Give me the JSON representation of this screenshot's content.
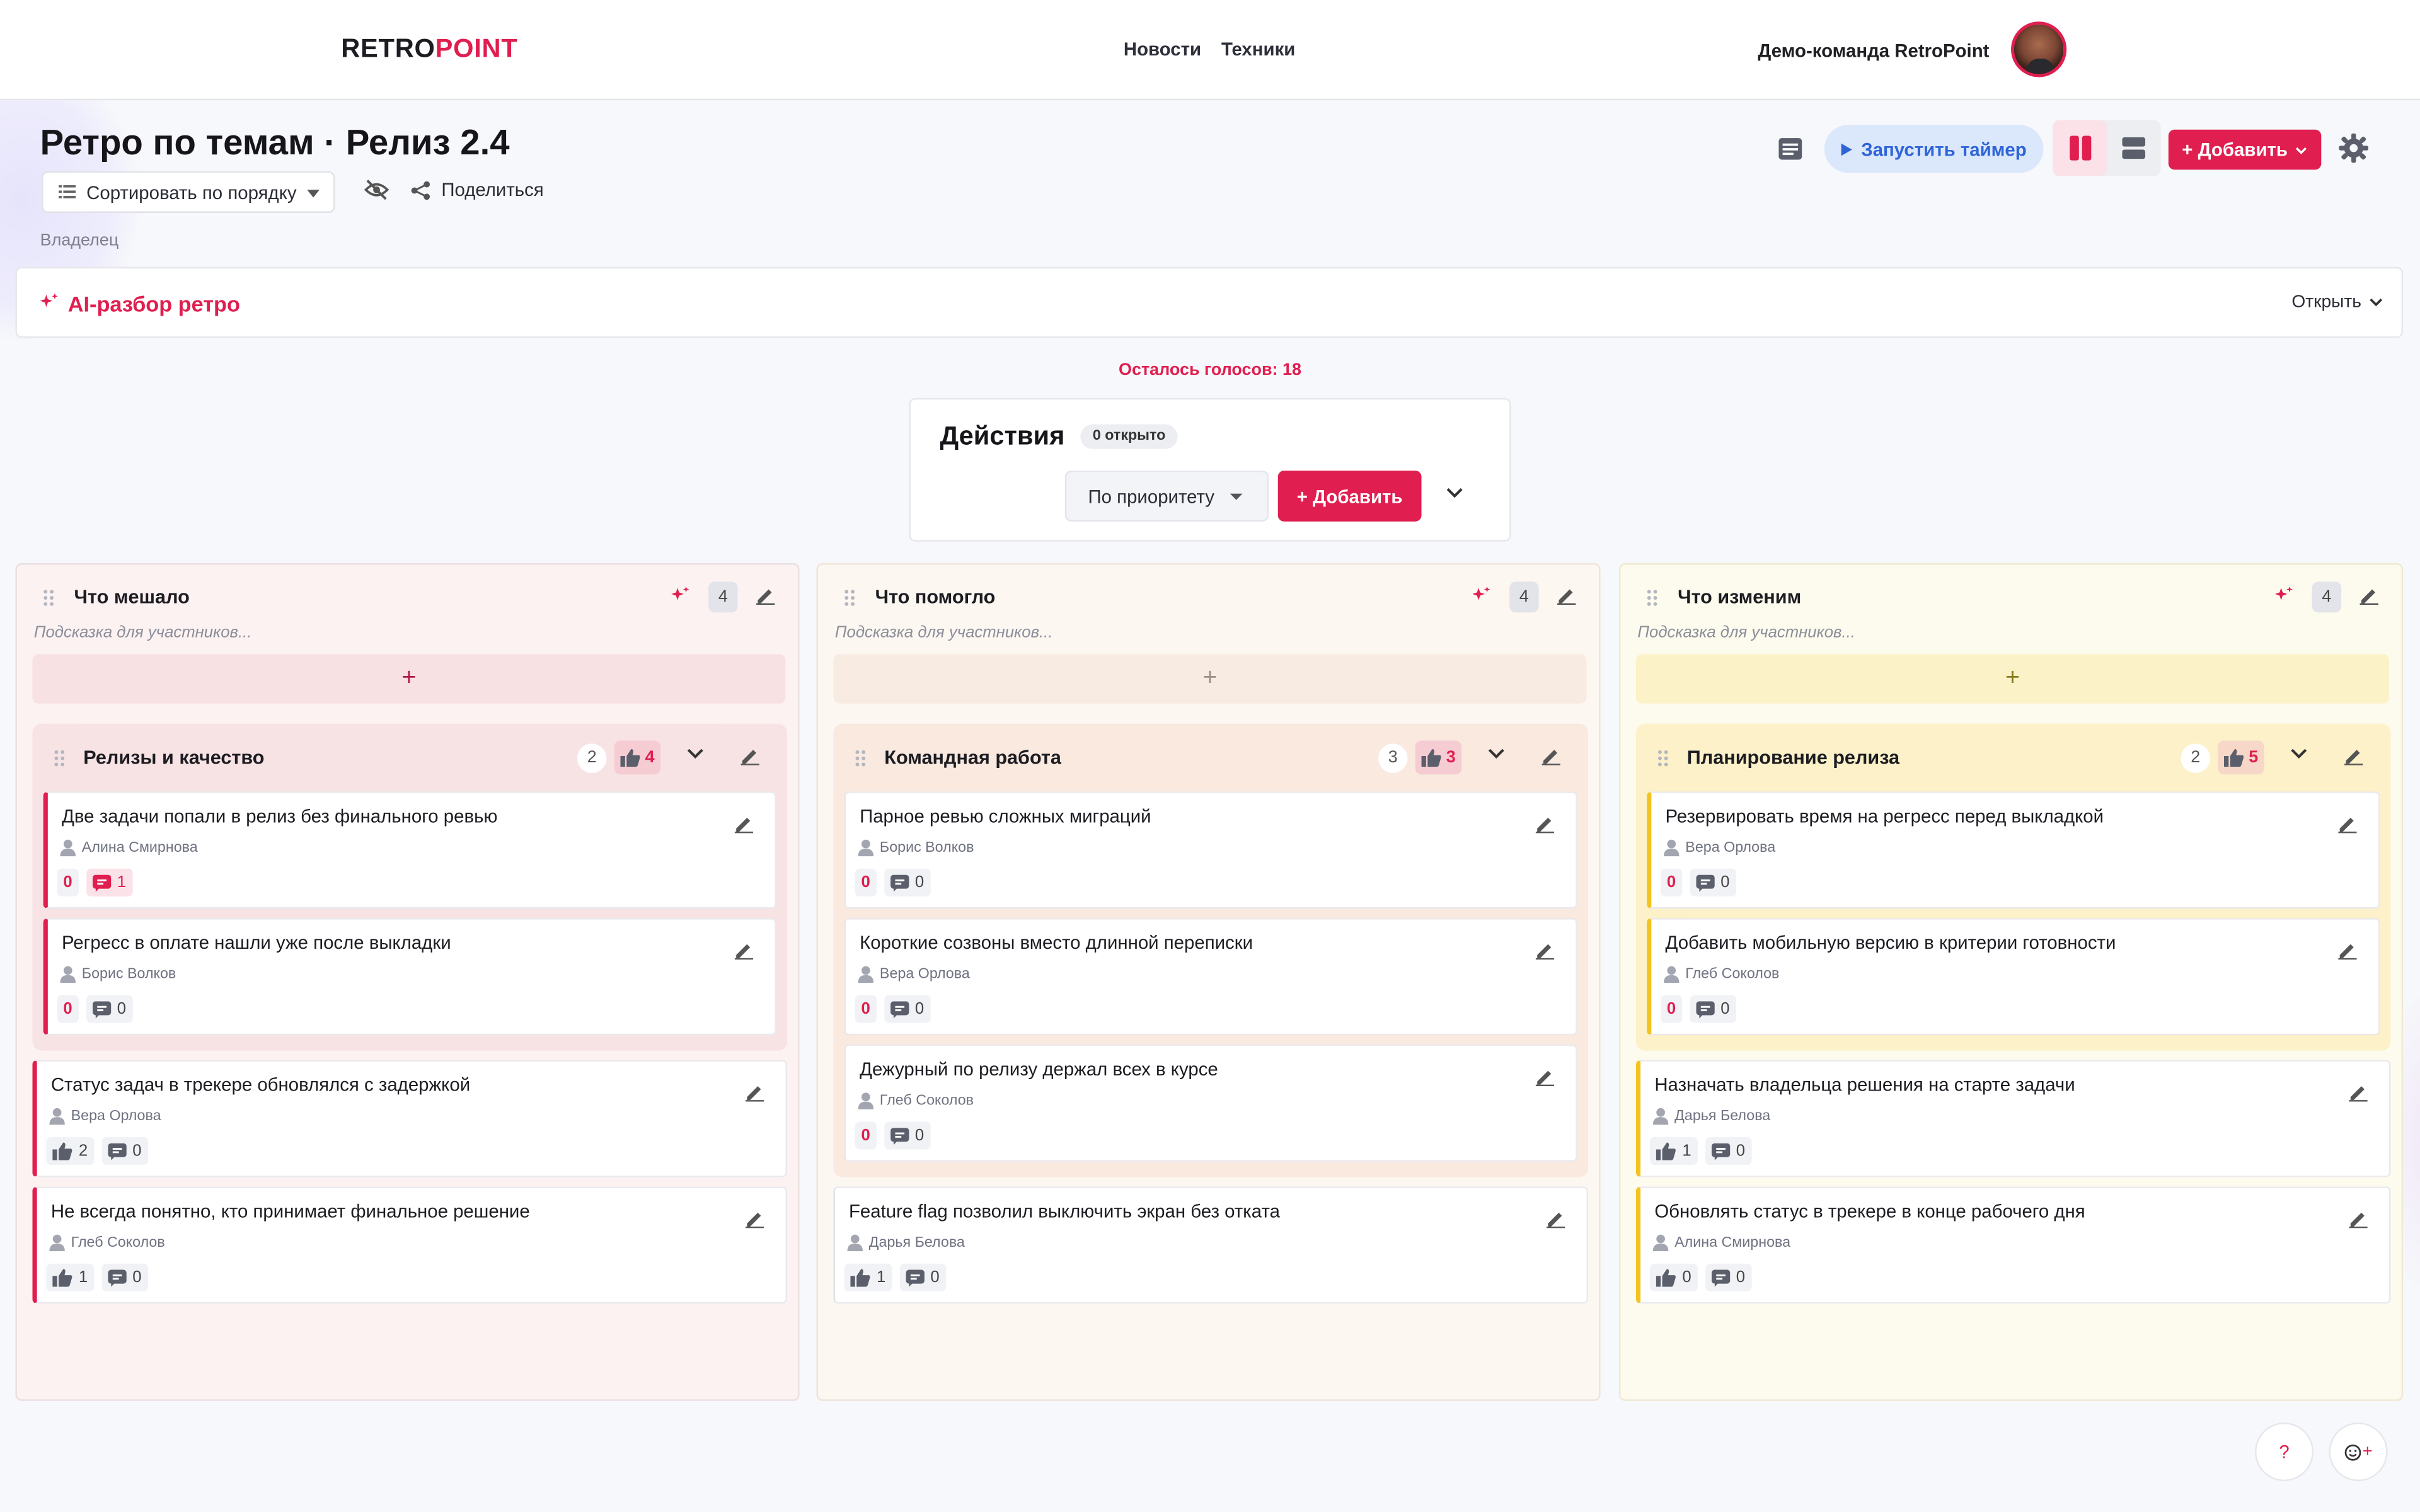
{
  "header": {
    "logo_part1": "RETRO",
    "logo_part2": "POINT",
    "nav": [
      "Новости",
      "Техники"
    ],
    "team_name": "Демо-команда RetroPoint"
  },
  "page": {
    "title": "Ретро по темам · Релиз 2.4",
    "sort_label": "Сортировать по порядку",
    "share_label": "Поделиться",
    "owner_label": "Владелец"
  },
  "toolbar": {
    "timer_label": "Запустить таймер",
    "add_label": "+ Добавить"
  },
  "ai_panel": {
    "title": "AI-разбор ретро",
    "open_label": "Открыть"
  },
  "votes_left": "Осталось голосов: 18",
  "actions": {
    "title": "Действия",
    "badge": "0 открыто",
    "priority_label": "По приоритету",
    "add_label": "+ Добавить"
  },
  "colors": {
    "accent": "#e01e4f",
    "col1_bg": "#fdf2f2",
    "col2_bg": "#fdf7f2",
    "col3_bg": "#fdfbee"
  },
  "columns": [
    {
      "title": "Что мешало",
      "count": "4",
      "hint": "Подсказка для участников...",
      "group": {
        "title": "Релизы и качество",
        "count": "2",
        "votes": "4",
        "cards": [
          {
            "title": "Две задачи попали в релиз без финального ревью",
            "author": "Алина Смирнова",
            "votes": "0",
            "comments": "1"
          },
          {
            "title": "Регресс в оплате нашли уже после выкладки",
            "author": "Борис Волков",
            "votes": "0",
            "comments": "0"
          }
        ]
      },
      "cards": [
        {
          "title": "Статус задач в трекере обновлялся с задержкой",
          "author": "Вера Орлова",
          "likes": "2",
          "comments": "0"
        },
        {
          "title": "Не всегда понятно, кто принимает финальное решение",
          "author": "Глеб Соколов",
          "likes": "1",
          "comments": "0"
        }
      ]
    },
    {
      "title": "Что помогло",
      "count": "4",
      "hint": "Подсказка для участников...",
      "group": {
        "title": "Командная работа",
        "count": "3",
        "votes": "3",
        "cards": [
          {
            "title": "Парное ревью сложных миграций",
            "author": "Борис Волков",
            "votes": "0",
            "comments": "0"
          },
          {
            "title": "Короткие созвоны вместо длинной переписки",
            "author": "Вера Орлова",
            "votes": "0",
            "comments": "0"
          },
          {
            "title": "Дежурный по релизу держал всех в курсе",
            "author": "Глеб Соколов",
            "votes": "0",
            "comments": "0"
          }
        ]
      },
      "cards": [
        {
          "title": "Feature flag позволил выключить экран без отката",
          "author": "Дарья Белова",
          "likes": "1",
          "comments": "0"
        }
      ]
    },
    {
      "title": "Что изменим",
      "count": "4",
      "hint": "Подсказка для участников...",
      "group": {
        "title": "Планирование релиза",
        "count": "2",
        "votes": "5",
        "cards": [
          {
            "title": "Резервировать время на регресс перед выкладкой",
            "author": "Вера Орлова",
            "votes": "0",
            "comments": "0"
          },
          {
            "title": "Добавить мобильную версию в критерии готовности",
            "author": "Глеб Соколов",
            "votes": "0",
            "comments": "0"
          }
        ]
      },
      "cards": [
        {
          "title": "Назначать владельца решения на старте задачи",
          "author": "Дарья Белова",
          "likes": "1",
          "comments": "0"
        },
        {
          "title": "Обновлять статус в трекере в конце рабочего дня",
          "author": "Алина Смирнова",
          "likes": "0",
          "comments": "0"
        }
      ]
    }
  ],
  "help_label": "?"
}
